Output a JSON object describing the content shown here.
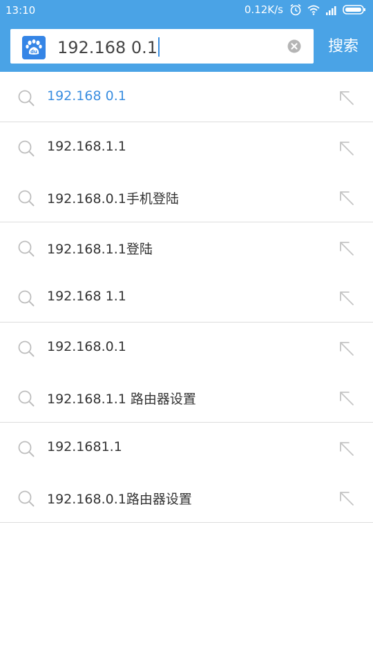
{
  "status_bar": {
    "time": "13:10",
    "network_speed": "0.12K/s",
    "icons": [
      "alarm-icon",
      "wifi-icon",
      "signal-icon",
      "battery-icon"
    ]
  },
  "search": {
    "query": "192.168 0.1",
    "logo_text": "du",
    "submit_label": "搜索"
  },
  "colors": {
    "accent": "#4aa3e6",
    "active_suggestion": "#3a8ee0",
    "text": "#333333",
    "icon_gray": "#bdbdbd"
  },
  "suggestions": [
    "192.168 0.1",
    "192.168.1.1",
    "192.168.0.1手机登陆",
    "192.168.1.1登陆",
    "192.168 1.1",
    "192.168.0.1",
    "192.168.1.1 路由器设置",
    "192.1681.1",
    "192.168.0.1路由器设置"
  ]
}
